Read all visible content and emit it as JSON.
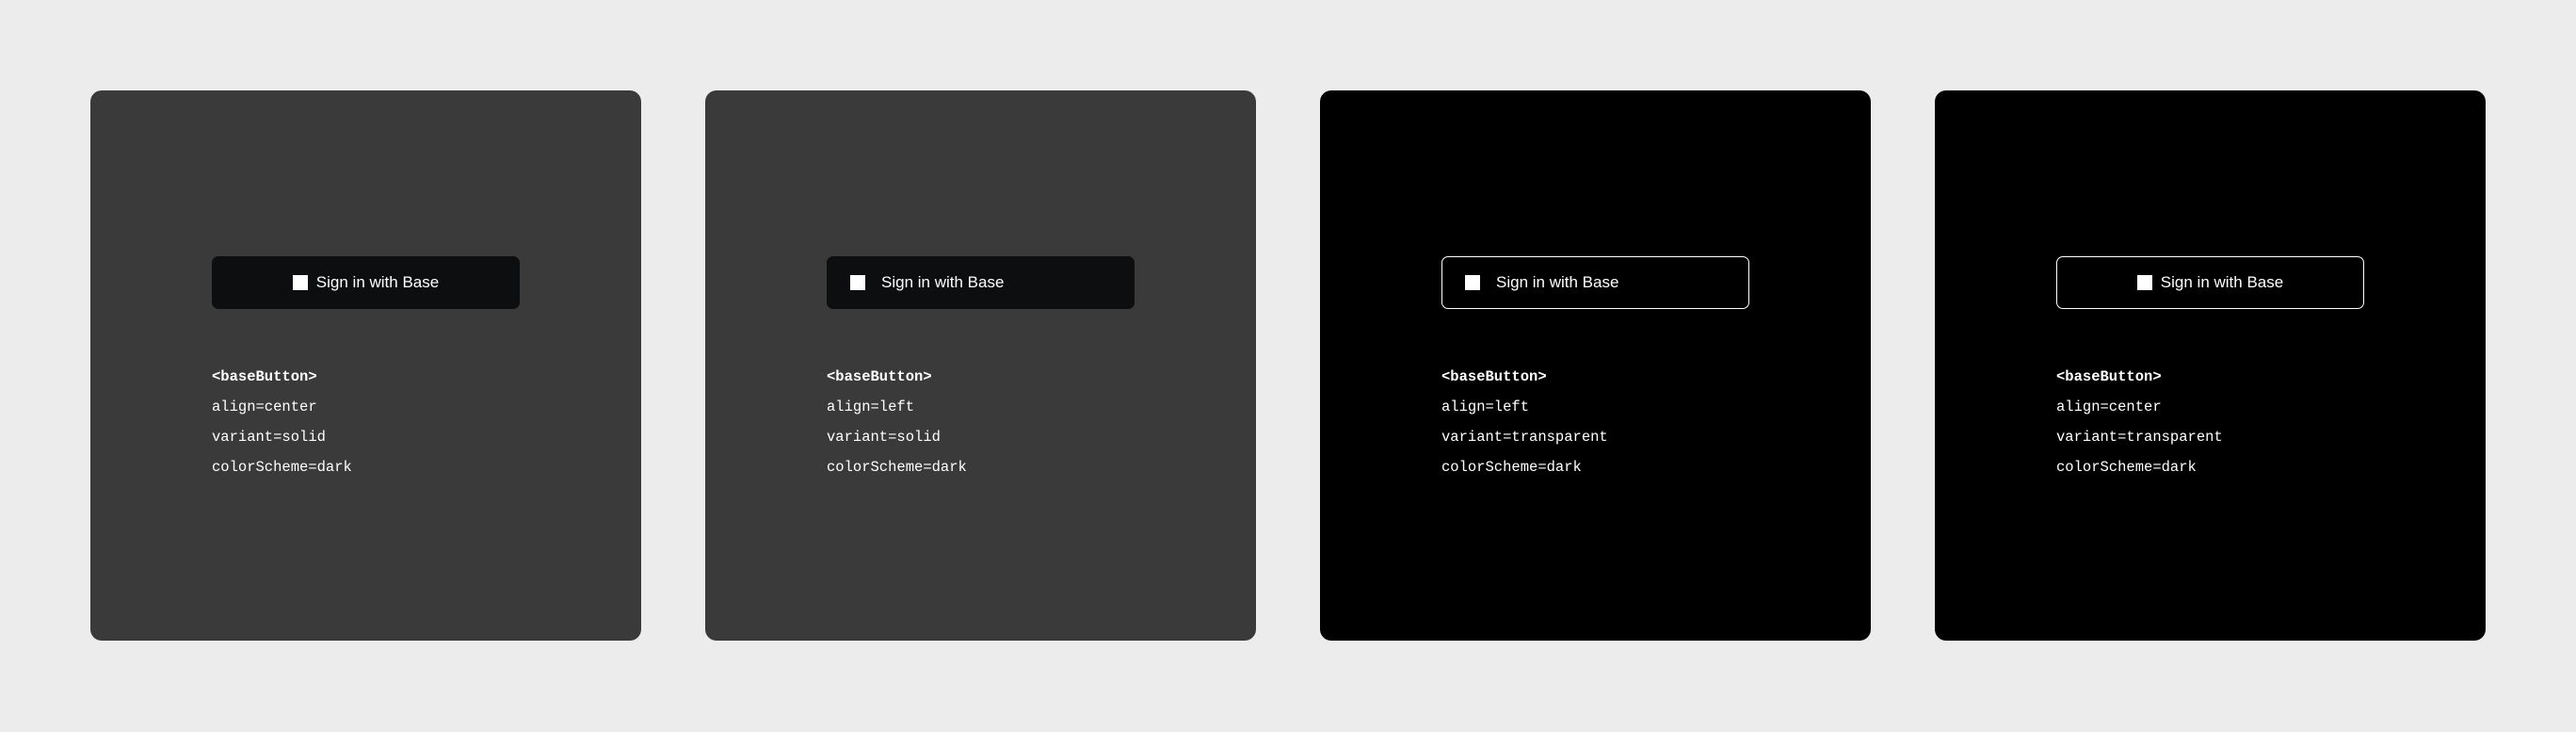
{
  "cards": [
    {
      "button_label": "Sign in with Base",
      "tag": "<baseButton>",
      "align": "align=center",
      "variant": "variant=solid",
      "color_scheme": "colorScheme=dark",
      "background_color": "#3a3a3a",
      "button_style": "solid",
      "button_align": "center"
    },
    {
      "button_label": "Sign in with Base",
      "tag": "<baseButton>",
      "align": "align=left",
      "variant": "variant=solid",
      "color_scheme": "colorScheme=dark",
      "background_color": "#3a3a3a",
      "button_style": "solid",
      "button_align": "left"
    },
    {
      "button_label": "Sign in with Base",
      "tag": "<baseButton>",
      "align": "align=left",
      "variant": "variant=transparent",
      "color_scheme": "colorScheme=dark",
      "background_color": "#000000",
      "button_style": "transparent",
      "button_align": "left"
    },
    {
      "button_label": "Sign in with Base",
      "tag": "<baseButton>",
      "align": "align=center",
      "variant": "variant=transparent",
      "color_scheme": "colorScheme=dark",
      "background_color": "#000000",
      "button_style": "transparent",
      "button_align": "center"
    }
  ],
  "colors": {
    "page_background": "#ececec",
    "solid_button": "#0d0e10",
    "text": "#ffffff"
  },
  "icons": {
    "button_icon": "base-square-icon"
  }
}
